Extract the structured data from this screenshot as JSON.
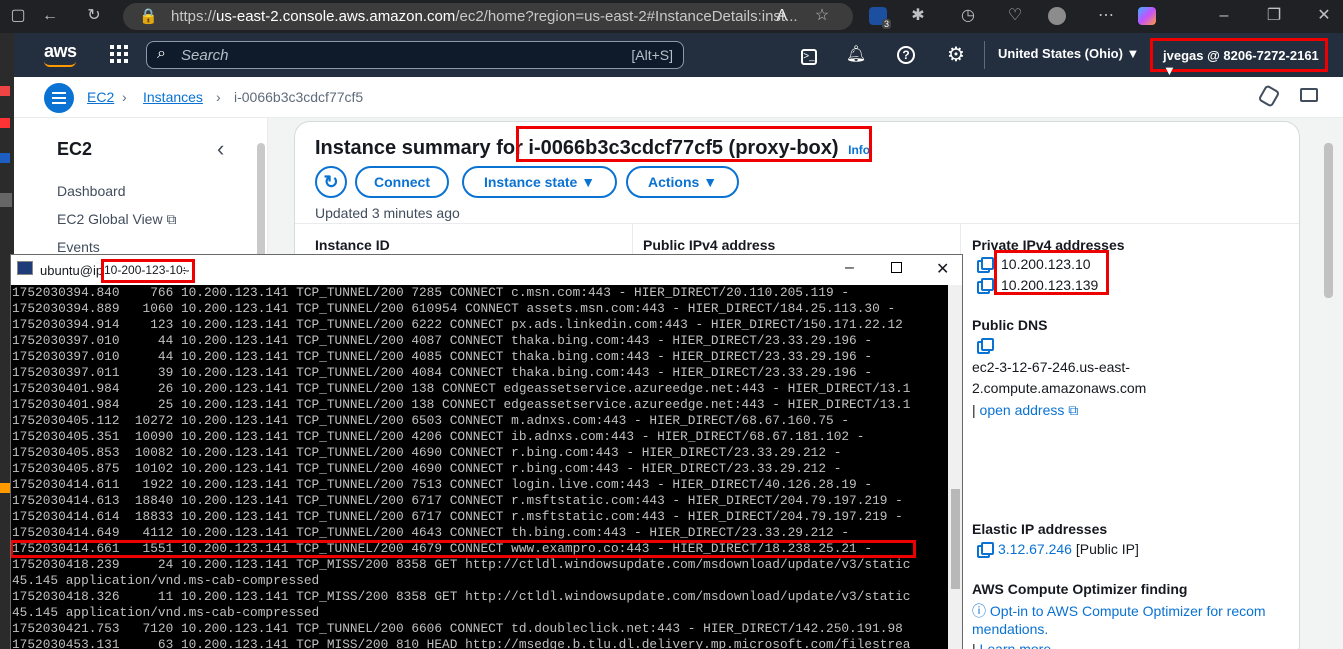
{
  "browser": {
    "url_prefix": "https://",
    "url_host": "us-east-2.console.aws.amazon.com",
    "url_path": "/ec2/home?region=us-east-2#InstanceDetails:inst...",
    "ext_badge": "3"
  },
  "aws": {
    "logo": "aws",
    "search_placeholder": "Search",
    "search_shortcut": "[Alt+S]",
    "region": "United States (Ohio) ▼",
    "account": "jvegas @ 8206-7272-2161 ▼"
  },
  "breadcrumb": {
    "items": [
      "EC2",
      "Instances",
      "i-0066b3c3cdcf77cf5"
    ]
  },
  "leftnav": {
    "title": "EC2",
    "items": [
      "Dashboard",
      "EC2 Global View",
      "Events"
    ]
  },
  "summary": {
    "title_prefix": "Instance summary for ",
    "title_id": "i-0066b3c3cdcf77cf5 (proxy-box)",
    "info": "Info",
    "connect": "Connect",
    "instance_state": "Instance state",
    "actions": "Actions",
    "updated": "Updated 3 minutes ago",
    "col1_label": "Instance ID",
    "col2_label": "Public IPv4 address",
    "private_ips_label": "Private IPv4 addresses",
    "private_ips": [
      "10.200.123.10",
      "10.200.123.139"
    ],
    "public_dns_label": "Public DNS",
    "public_dns_1": "ec2-3-12-67-246.us-east-",
    "public_dns_2": "2.compute.amazonaws.com",
    "open_address": "open address",
    "elastic_label": "Elastic IP addresses",
    "elastic_ip": "3.12.67.246",
    "elastic_note": "[Public IP]",
    "optimizer_label": "AWS Compute Optimizer finding",
    "optimizer_link_1": "Opt-in to AWS Compute Optimizer for recom",
    "optimizer_link_2": "mendations.",
    "learn_more": "Learn more"
  },
  "terminal": {
    "title_prefix": "ubuntu@ip",
    "title_highlight": "10-200-123-10:",
    "title_suffix": " ~",
    "lines": [
      "1752030394.840    766 10.200.123.141 TCP_TUNNEL/200 7285 CONNECT c.msn.com:443 - HIER_DIRECT/20.110.205.119 -",
      "1752030394.889   1060 10.200.123.141 TCP_TUNNEL/200 610954 CONNECT assets.msn.com:443 - HIER_DIRECT/184.25.113.30 -",
      "1752030394.914    123 10.200.123.141 TCP_TUNNEL/200 6222 CONNECT px.ads.linkedin.com:443 - HIER_DIRECT/150.171.22.12",
      "1752030397.010     44 10.200.123.141 TCP_TUNNEL/200 4087 CONNECT thaka.bing.com:443 - HIER_DIRECT/23.33.29.196 -",
      "1752030397.010     44 10.200.123.141 TCP_TUNNEL/200 4085 CONNECT thaka.bing.com:443 - HIER_DIRECT/23.33.29.196 -",
      "1752030397.011     39 10.200.123.141 TCP_TUNNEL/200 4084 CONNECT thaka.bing.com:443 - HIER_DIRECT/23.33.29.196 -",
      "1752030401.984     26 10.200.123.141 TCP_TUNNEL/200 138 CONNECT edgeassetservice.azureedge.net:443 - HIER_DIRECT/13.1",
      "1752030401.984     25 10.200.123.141 TCP_TUNNEL/200 138 CONNECT edgeassetservice.azureedge.net:443 - HIER_DIRECT/13.1",
      "1752030405.112  10272 10.200.123.141 TCP_TUNNEL/200 6503 CONNECT m.adnxs.com:443 - HIER_DIRECT/68.67.160.75 -",
      "1752030405.351  10090 10.200.123.141 TCP_TUNNEL/200 4206 CONNECT ib.adnxs.com:443 - HIER_DIRECT/68.67.181.102 -",
      "1752030405.853  10082 10.200.123.141 TCP_TUNNEL/200 4690 CONNECT r.bing.com:443 - HIER_DIRECT/23.33.29.212 -",
      "1752030405.875  10102 10.200.123.141 TCP_TUNNEL/200 4690 CONNECT r.bing.com:443 - HIER_DIRECT/23.33.29.212 -",
      "1752030414.611   1922 10.200.123.141 TCP_TUNNEL/200 7513 CONNECT login.live.com:443 - HIER_DIRECT/40.126.28.19 -",
      "1752030414.613  18840 10.200.123.141 TCP_TUNNEL/200 6717 CONNECT r.msftstatic.com:443 - HIER_DIRECT/204.79.197.219 -",
      "1752030414.614  18833 10.200.123.141 TCP_TUNNEL/200 6717 CONNECT r.msftstatic.com:443 - HIER_DIRECT/204.79.197.219 -",
      "1752030414.649   4112 10.200.123.141 TCP_TUNNEL/200 4643 CONNECT th.bing.com:443 - HIER_DIRECT/23.33.29.212 -",
      "1752030414.661   1551 10.200.123.141 TCP_TUNNEL/200 4679 CONNECT www.exampro.co:443 - HIER_DIRECT/18.238.25.21 -",
      "1752030418.239     24 10.200.123.141 TCP_MISS/200 8358 GET http://ctldl.windowsupdate.com/msdownload/update/v3/static",
      "45.145 application/vnd.ms-cab-compressed",
      "1752030418.326     11 10.200.123.141 TCP_MISS/200 8358 GET http://ctldl.windowsupdate.com/msdownload/update/v3/static",
      "45.145 application/vnd.ms-cab-compressed",
      "1752030421.753   7120 10.200.123.141 TCP_TUNNEL/200 6606 CONNECT td.doubleclick.net:443 - HIER_DIRECT/142.250.191.98",
      "1752030453.131     63 10.200.123.141 TCP_MISS/200 810 HEAD http://msedge.b.tlu.dl.delivery.mp.microsoft.com/filestrea"
    ]
  }
}
